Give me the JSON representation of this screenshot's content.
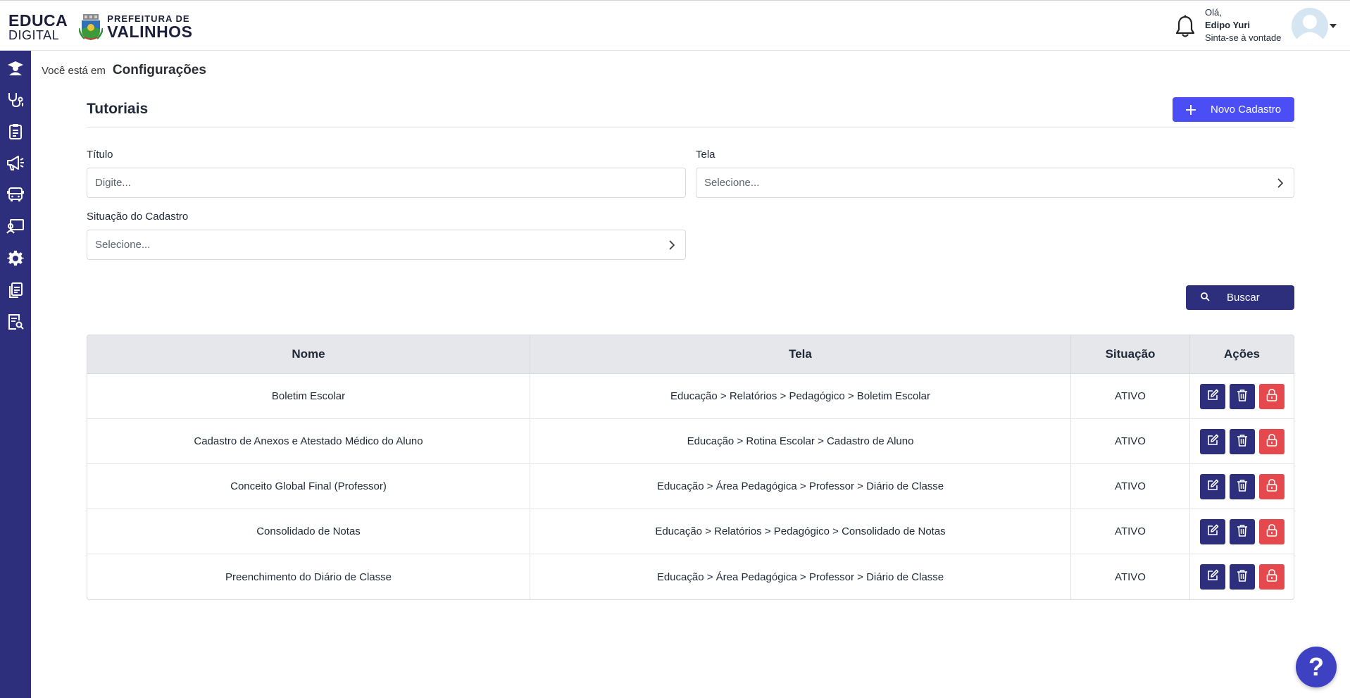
{
  "header": {
    "brand_line1": "EDUCA",
    "brand_line2": "DIGITAL",
    "city_line1": "PREFEITURA DE",
    "city_line2": "VALINHOS",
    "greeting": "Olá,",
    "user_name": "Edipo Yuri",
    "welcome": "Sinta-se à vontade"
  },
  "sidebar": {
    "icons": [
      "student-icon",
      "stethoscope-icon",
      "clipboard-icon",
      "megaphone-icon",
      "bus-icon",
      "teacher-icon",
      "gear-icon",
      "documents-icon",
      "report-search-icon"
    ]
  },
  "breadcrumb": {
    "prefix": "Você está em",
    "current": "Configurações"
  },
  "page": {
    "title": "Tutoriais",
    "new_button": "Novo Cadastro"
  },
  "filters": {
    "titulo_label": "Título",
    "titulo_placeholder": "Digite...",
    "tela_label": "Tela",
    "tela_placeholder": "Selecione...",
    "situacao_label": "Situação do Cadastro",
    "situacao_placeholder": "Selecione...",
    "search_button": "Buscar"
  },
  "table": {
    "headers": [
      "Nome",
      "Tela",
      "Situação",
      "Ações"
    ],
    "rows": [
      {
        "nome": "Boletim Escolar",
        "tela": "Educação > Relatórios > Pedagógico > Boletim Escolar",
        "situacao": "ATIVO"
      },
      {
        "nome": "Cadastro de Anexos e Atestado Médico do Aluno",
        "tela": "Educação > Rotina Escolar > Cadastro de Aluno",
        "situacao": "ATIVO"
      },
      {
        "nome": "Conceito Global Final (Professor)",
        "tela": "Educação > Área Pedagógica > Professor > Diário de Classe",
        "situacao": "ATIVO"
      },
      {
        "nome": "Consolidado de Notas",
        "tela": "Educação > Relatórios > Pedagógico > Consolidado de Notas",
        "situacao": "ATIVO"
      },
      {
        "nome": "Preenchimento do Diário de Classe",
        "tela": "Educação > Área Pedagógica > Professor > Diário de Classe",
        "situacao": "ATIVO"
      }
    ]
  },
  "help": {
    "label": "?"
  },
  "colors": {
    "sidebar": "#2d2f7c",
    "primary": "#4a4ef4",
    "danger": "#e5484d"
  }
}
